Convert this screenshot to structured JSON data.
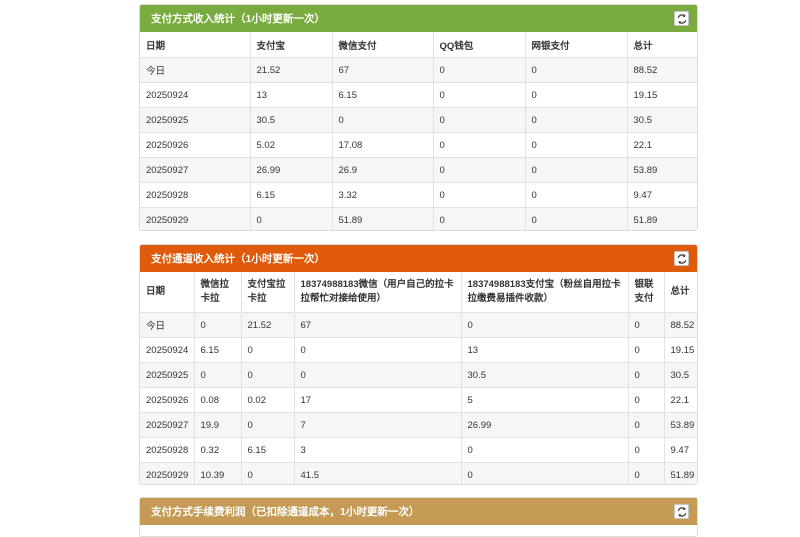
{
  "panel1": {
    "title": "支付方式收入统计（1小时更新一次）",
    "headers": [
      "日期",
      "支付宝",
      "微信支付",
      "QQ钱包",
      "网银支付",
      "总计"
    ],
    "rows": [
      [
        "今日",
        "21.52",
        "67",
        "0",
        "0",
        "88.52"
      ],
      [
        "20250924",
        "13",
        "6.15",
        "0",
        "0",
        "19.15"
      ],
      [
        "20250925",
        "30.5",
        "0",
        "0",
        "0",
        "30.5"
      ],
      [
        "20250926",
        "5.02",
        "17.08",
        "0",
        "0",
        "22.1"
      ],
      [
        "20250927",
        "26.99",
        "26.9",
        "0",
        "0",
        "53.89"
      ],
      [
        "20250928",
        "6.15",
        "3.32",
        "0",
        "0",
        "9.47"
      ],
      [
        "20250929",
        "0",
        "51.89",
        "0",
        "0",
        "51.89"
      ]
    ]
  },
  "panel2": {
    "title": "支付通道收入统计（1小时更新一次）",
    "headers": [
      "日期",
      "微信拉卡拉",
      "支付宝拉卡拉",
      "18374988183微信（用户自己的拉卡拉帮忙对接给使用）",
      "18374988183支付宝（粉丝自用拉卡拉缴费易插件收款）",
      "银联支付",
      "总计"
    ],
    "rows": [
      [
        "今日",
        "0",
        "21.52",
        "67",
        "0",
        "0",
        "88.52"
      ],
      [
        "20250924",
        "6.15",
        "0",
        "0",
        "13",
        "0",
        "19.15"
      ],
      [
        "20250925",
        "0",
        "0",
        "0",
        "30.5",
        "0",
        "30.5"
      ],
      [
        "20250926",
        "0.08",
        "0.02",
        "17",
        "5",
        "0",
        "22.1"
      ],
      [
        "20250927",
        "19.9",
        "0",
        "7",
        "26.99",
        "0",
        "53.89"
      ],
      [
        "20250928",
        "0.32",
        "6.15",
        "3",
        "0",
        "0",
        "9.47"
      ],
      [
        "20250929",
        "10.39",
        "0",
        "41.5",
        "0",
        "0",
        "51.89"
      ]
    ]
  },
  "panel3": {
    "title": "支付方式手续费利润（已扣除通道成本，1小时更新一次）"
  },
  "icons": {
    "refresh": "refresh-icon"
  },
  "colors": {
    "panel1_header": "#7aab3f",
    "panel2_header": "#df5a0a",
    "panel3_header": "#c49a55"
  }
}
